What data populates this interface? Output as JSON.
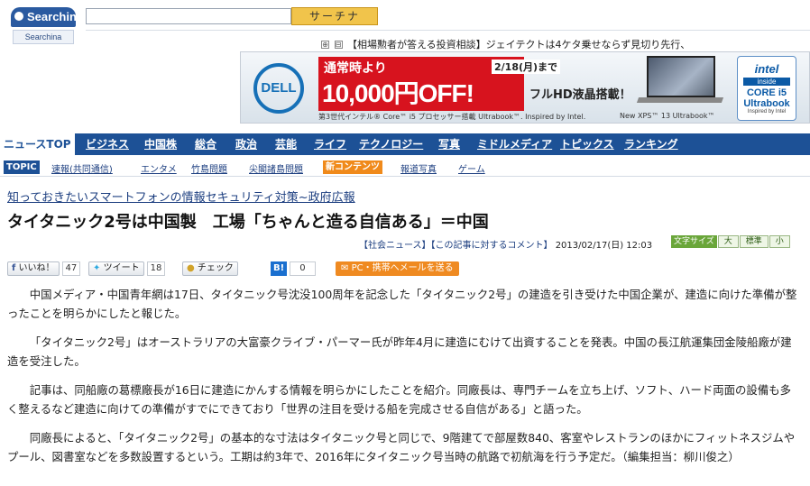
{
  "header": {
    "logo_text": "Searchina",
    "logo_tab": "Searchina",
    "search_placeholder": "",
    "search_button": "サーチナ"
  },
  "ticker": {
    "icons": [
      "⊕",
      "⊟"
    ],
    "text": "【相場勲者が答える投資相談】ジェイテクトは4ケタ乗せならず見切り先行、"
  },
  "banner": {
    "brand": "DELL",
    "promo_line1": "通常時より",
    "promo_line2": "10,000円OFF!",
    "promo_date": "2/18(月)まで",
    "promo_sub": "フルHD液晶搭載！",
    "note_left": "第3世代インテル® Core™ i5 プロセッサー搭載 Ultrabook™. Inspired by Intel.",
    "note_right": "New XPS™ 13 Ultrabook™",
    "intel_line1": "intel",
    "intel_line2": "inside",
    "intel_line3": "CORE i5",
    "intel_line4": "Ultrabook",
    "intel_line5": "Inspired by Intel"
  },
  "nav": {
    "items": [
      "ニュースTOP",
      "ビジネス",
      "中国株",
      "総合",
      "政治",
      "芸能",
      "ライフ",
      "テクノロジー",
      "写真",
      "ミドルメディア",
      "トピックス",
      "ランキング"
    ]
  },
  "subnav": {
    "topic_label": "TOPIC",
    "items": [
      "速報(共同通信)",
      "エンタメ",
      "竹島問題",
      "尖閣諸島問題"
    ],
    "new_label": "新コンテンツ",
    "new_items": [
      "報道写真",
      "ゲーム"
    ]
  },
  "article": {
    "pr_link": "知っておきたいスマートフォンの情報セキュリティ対策~政府広報",
    "headline": "タイタニック2号は中国製　工場「ちゃんと造る自信ある」＝中国",
    "category": "【社会ニュース】",
    "comment_link": "【この記事に対するコメント】",
    "date": "2013/02/17(日) 12:03",
    "fontsize_label": "文字サイズ",
    "fontsize_options": [
      "大",
      "標準",
      "小"
    ],
    "paragraphs": [
      "中国メディア・中国青年網は17日、タイタニック号沈没100周年を記念した「タイタニック2号」の建造を引き受けた中国企業が、建造に向けた準備が整ったことを明らかにしたと報じた。",
      "「タイタニック2号」はオーストラリアの大富豪クライブ・パーマー氏が昨年4月に建造にむけて出資することを発表。中国の長江航運集団金陵船廠が建造を受注した。",
      "記事は、同船廠の葛標廠長が16日に建造にかんする情報を明らかにしたことを紹介。同廠長は、専門チームを立ち上げ、ソフト、ハード両面の設備も多く整えるなど建造に向けての準備がすでにできており「世界の注目を受ける船を完成させる自信がある」と語った。",
      "同廠長によると、「タイタニック2号」の基本的な寸法はタイタニック号と同じで、9階建てで部屋数840、客室やレストランのほかにフィットネスジムやプール、図書室などを多数設置するという。工期は約3年で、2016年にタイタニック号当時の航路で初航海を行う予定だ。（編集担当：柳川俊之）"
    ]
  },
  "social": {
    "facebook_label": "いいね！",
    "facebook_count": "47",
    "tweet_label": "ツイート",
    "tweet_count": "18",
    "mixi_label": "チェック",
    "hatena_label": "B!",
    "hatena_count": "0",
    "mail_label": "PC・携帯へメールを送る"
  },
  "colors": {
    "nav_bg": "#1d5196",
    "search_button": "#f1c44b",
    "promo_red": "#d7131e",
    "mail_orange": "#ef8a21",
    "fontsize_green": "#6aa63a"
  }
}
